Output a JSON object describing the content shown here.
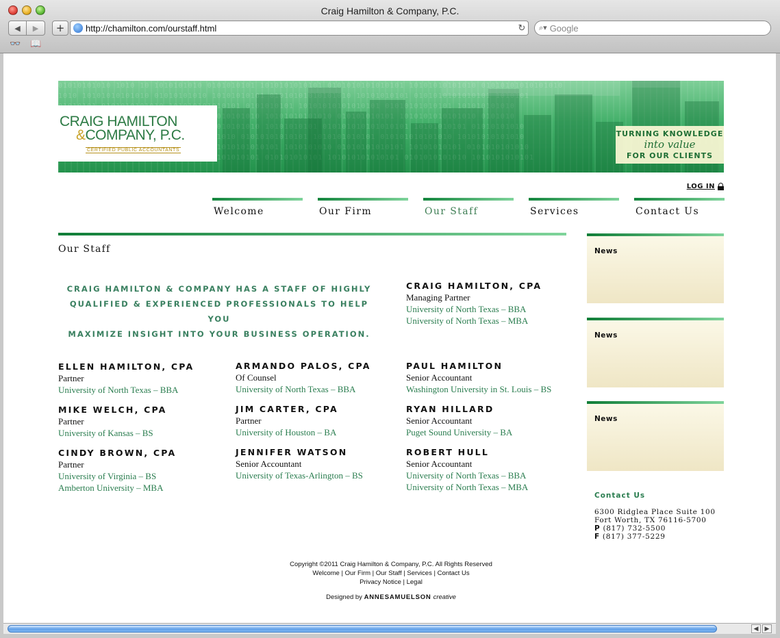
{
  "browser": {
    "window_title": "Craig Hamilton & Company, P.C.",
    "url": "http://chamilton.com/ourstaff.html",
    "search_placeholder": "Google"
  },
  "header": {
    "logo_line1": "CRAIG HAMILTON",
    "logo_amp": "&",
    "logo_line2": "COMPANY, P.C.",
    "logo_sub": "CERTIFIED PUBLIC ACCOUNTANTS",
    "tagline_line1": "TURNING KNOWLEDGE",
    "tagline_line2": "into value",
    "tagline_line3": "FOR OUR CLIENTS",
    "login_label": "LOG IN"
  },
  "nav": [
    {
      "label": "Welcome",
      "active": false
    },
    {
      "label": "Our Firm",
      "active": false
    },
    {
      "label": "Our Staff",
      "active": true
    },
    {
      "label": "Services",
      "active": false
    },
    {
      "label": "Contact Us",
      "active": false
    }
  ],
  "main": {
    "page_title": "Our Staff",
    "intro_lines": [
      "CRAIG HAMILTON & COMPANY HAS A STAFF OF HIGHLY",
      "QUALIFIED & EXPERIENCED PROFESSIONALS TO HELP YOU",
      "MAXIMIZE INSIGHT INTO YOUR BUSINESS OPERATION."
    ],
    "lead": {
      "name": "CRAIG HAMILTON, CPA",
      "role": "Managing Partner",
      "education": [
        "University of North Texas – BBA",
        "University of North Texas – MBA"
      ]
    },
    "staff": [
      {
        "name": "ELLEN HAMILTON, CPA",
        "role": "Partner",
        "education": [
          "University of North Texas – BBA"
        ]
      },
      {
        "name": "ARMANDO PALOS, CPA",
        "role": "Of Counsel",
        "education": [
          "University of North Texas – BBA"
        ]
      },
      {
        "name": "PAUL HAMILTON",
        "role": "Senior Accountant",
        "education": [
          "Washington University in St. Louis – BS"
        ]
      },
      {
        "name": "MIKE WELCH, CPA",
        "role": "Partner",
        "education": [
          "University of Kansas – BS"
        ]
      },
      {
        "name": "JIM CARTER, CPA",
        "role": "Partner",
        "education": [
          "University of Houston – BA"
        ]
      },
      {
        "name": "RYAN HILLARD",
        "role": "Senior Accountant",
        "education": [
          "Puget Sound University – BA"
        ]
      },
      {
        "name": "CINDY BROWN, CPA",
        "role": "Partner",
        "education": [
          "University of Virginia – BS",
          "Amberton University – MBA"
        ]
      },
      {
        "name": "JENNIFER WATSON",
        "role": "Senior Accountant",
        "education": [
          "University of Texas-Arlington – BS"
        ]
      },
      {
        "name": "ROBERT HULL",
        "role": "Senior Accountant",
        "education": [
          "University of North Texas – BBA",
          "University of North Texas – MBA"
        ]
      }
    ]
  },
  "sidebar": {
    "news_boxes": [
      "News",
      "News",
      "News"
    ],
    "contact": {
      "title": "Contact Us",
      "address1": "6300 Ridglea Place Suite 100",
      "address2": "Fort Worth, TX 76116-5700",
      "phone_label": "P",
      "phone": "(817) 732-5500",
      "fax_label": "F",
      "fax": "(817) 377-5229"
    }
  },
  "footer": {
    "copyright": "Copyright ©2011 Craig Hamilton & Company, P.C. All Rights Reserved",
    "links_row1": [
      "Welcome",
      "Our Firm",
      "Our Staff",
      "Services",
      "Contact Us"
    ],
    "links_row2": [
      "Privacy Notice",
      "Legal"
    ],
    "designed_by": "Designed by",
    "designer": "ANNESAMUELSON",
    "designer_suffix": "creative"
  },
  "colors": {
    "brand_green": "#12843c",
    "accent_green": "#2a7d4f",
    "news_bg": "#efe6c5"
  }
}
